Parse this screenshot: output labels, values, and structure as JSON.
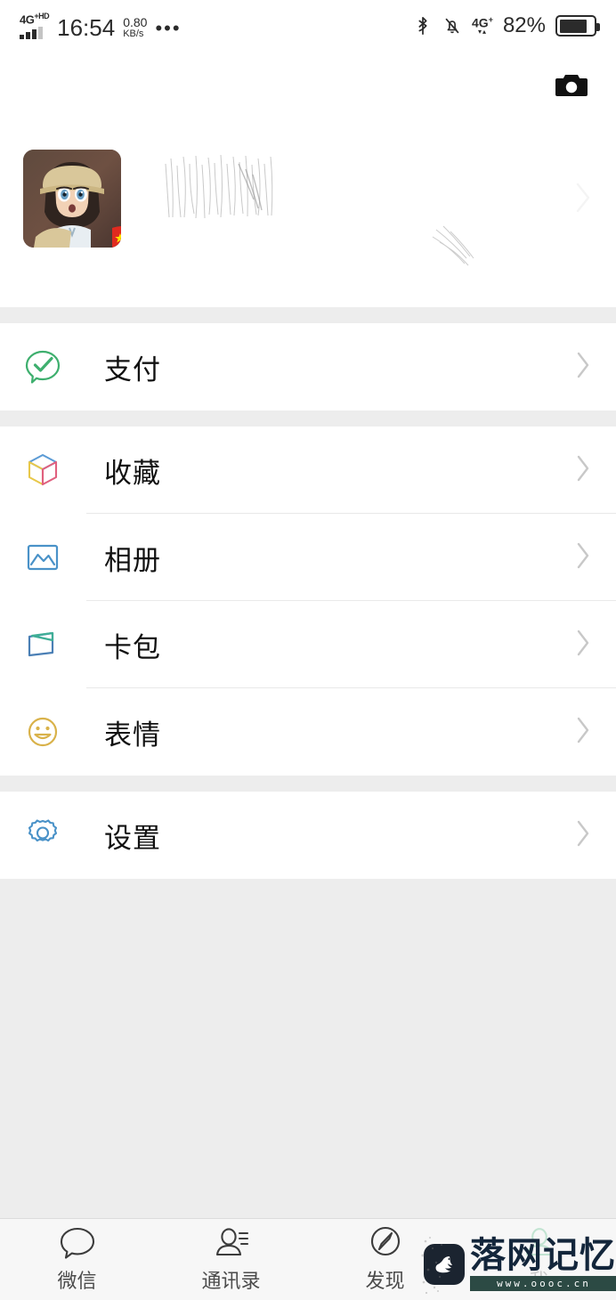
{
  "status_bar": {
    "network_type": "4G",
    "network_sup": "+HD",
    "time": "16:54",
    "data_speed_value": "0.80",
    "data_speed_unit": "KB/s",
    "more_dots": "•••",
    "bluetooth_icon": "bluetooth-icon",
    "mute_icon": "bell-muted-icon",
    "network2_label": "4G",
    "network2_sup": "+",
    "battery_percent": "82%",
    "battery_level": 82
  },
  "header": {
    "camera_icon": "camera-icon",
    "avatar_alt": "avatar",
    "flag_badge": "china-flag-badge",
    "nickname": "",
    "wechat_id": "",
    "chevron_icon": "chevron-right-icon"
  },
  "menu": {
    "groups": [
      {
        "items": [
          {
            "label": "支付",
            "icon": "pay-check-bubble-icon",
            "chevron": "chevron-right-icon"
          }
        ]
      },
      {
        "items": [
          {
            "label": "收藏",
            "icon": "favorites-cube-icon",
            "chevron": "chevron-right-icon"
          },
          {
            "label": "相册",
            "icon": "album-photo-icon",
            "chevron": "chevron-right-icon"
          },
          {
            "label": "卡包",
            "icon": "cards-wallet-icon",
            "chevron": "chevron-right-icon"
          },
          {
            "label": "表情",
            "icon": "sticker-smiley-icon",
            "chevron": "chevron-right-icon"
          }
        ]
      },
      {
        "items": [
          {
            "label": "设置",
            "icon": "settings-gear-icon",
            "chevron": "chevron-right-icon"
          }
        ]
      }
    ]
  },
  "tabbar": {
    "tabs": [
      {
        "label": "微信",
        "icon": "chat-bubble-icon",
        "active": false
      },
      {
        "label": "通讯录",
        "icon": "contacts-person-icon",
        "active": false
      },
      {
        "label": "发现",
        "icon": "discover-compass-icon",
        "active": false
      },
      {
        "label": "我",
        "icon": "me-person-icon",
        "active": true
      }
    ]
  },
  "watermark": {
    "brand": "落网记忆",
    "url": "www.oooc.cn",
    "logo_icon": "swan-logo-icon"
  },
  "colors": {
    "page_bg": "#ededed",
    "card_bg": "#ffffff",
    "divider": "#e9e9e9",
    "text": "#111111",
    "tab_text": "#4b4b4b",
    "pay_green": "#3eaf6e",
    "album_blue": "#4a92c8",
    "cards_blue": "#4a7fb5",
    "sticker_gold": "#d9b24a",
    "gear_blue": "#4a92c8",
    "flag_red": "#e02a1f",
    "chevron": "#c8c8c8",
    "watermark_navy": "#13263b"
  }
}
